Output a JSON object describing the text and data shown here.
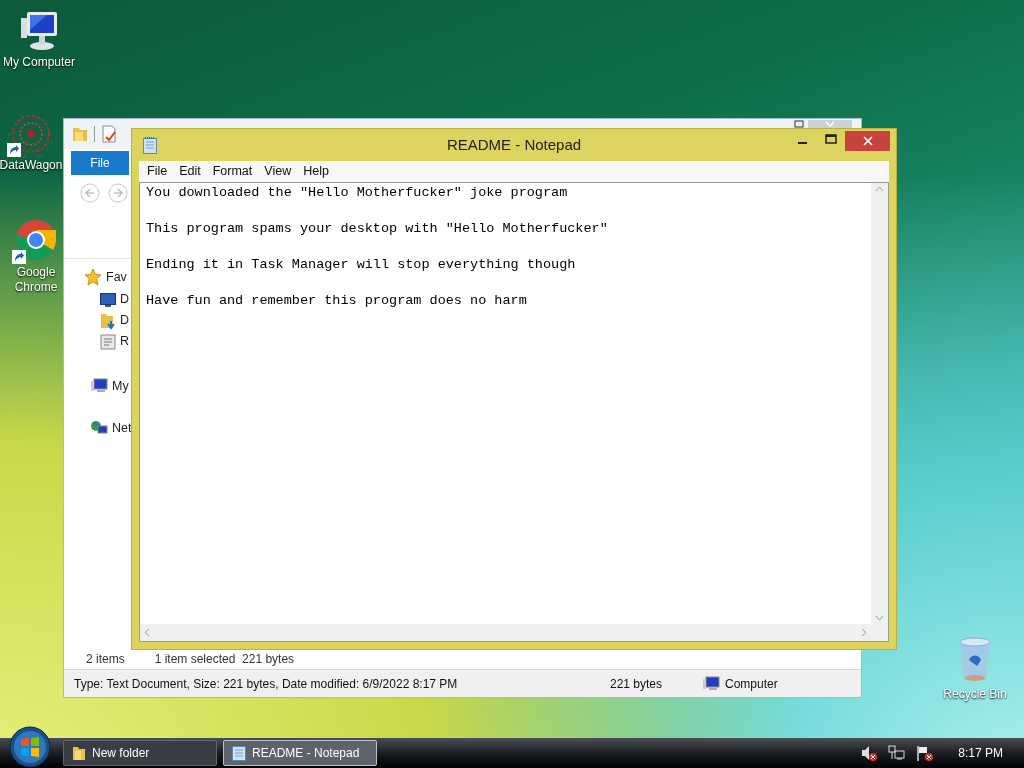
{
  "desktop_icons": [
    {
      "label": "My Computer",
      "kind": "computer",
      "shortcut": false
    },
    {
      "label": "DataWagon",
      "kind": "datawagon",
      "shortcut": true
    },
    {
      "label": "Google Chrome",
      "kind": "chrome",
      "shortcut": true
    },
    {
      "label": "Recycle Bin",
      "kind": "recycle",
      "shortcut": false
    }
  ],
  "explorer": {
    "ribbon_tab": "File",
    "sidebar": [
      {
        "label": "Fav",
        "kind": "star"
      },
      {
        "label": "D",
        "kind": "desktop"
      },
      {
        "label": "D",
        "kind": "downloads"
      },
      {
        "label": "R",
        "kind": "recent"
      },
      {
        "label": "My",
        "kind": "computer"
      },
      {
        "label": "Net",
        "kind": "network"
      }
    ],
    "item_count": "2 items",
    "selection": "1 item selected  221 bytes",
    "details": "Type: Text Document, Size: 221 bytes, Date modified: 6/9/2022 8:17 PM",
    "size": "221 bytes",
    "location": "Computer"
  },
  "notepad": {
    "title": "README - Notepad",
    "menu": [
      "File",
      "Edit",
      "Format",
      "View",
      "Help"
    ],
    "lines": [
      "You downloaded the \"Hello Motherfucker\" joke program",
      "This program spams your desktop with \"Hello Motherfucker\"",
      "Ending it in Task Manager will stop everything though",
      "Have fun and remember this program does no harm"
    ]
  },
  "taskbar": {
    "buttons": [
      {
        "label": "New folder",
        "kind": "folder",
        "selected": false
      },
      {
        "label": "README - Notepad",
        "kind": "notepad",
        "selected": true
      }
    ],
    "clock": "8:17 PM"
  }
}
